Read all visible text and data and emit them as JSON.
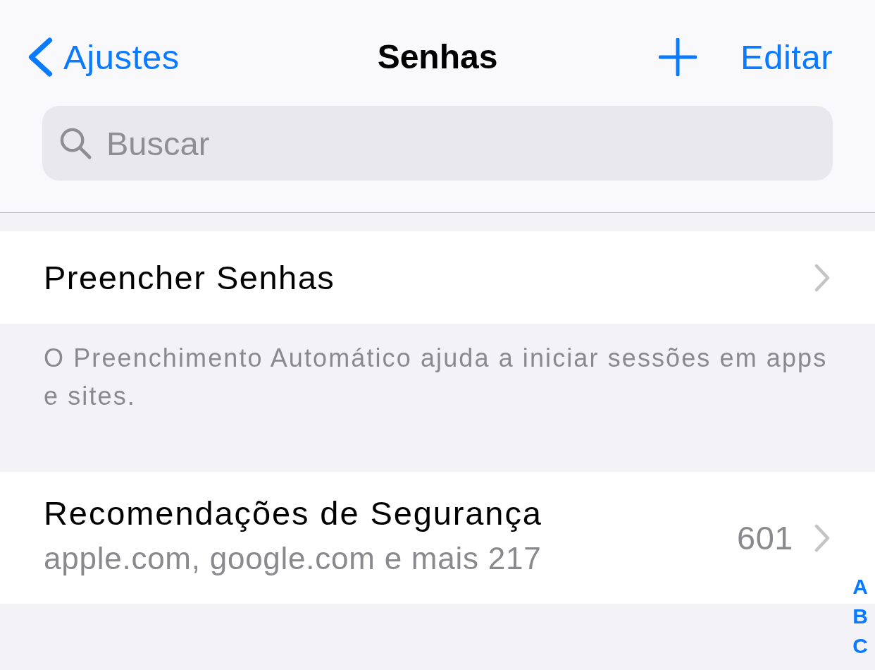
{
  "nav_bar": {
    "back_label": "Ajustes",
    "title": "Senhas",
    "edit_label": "Editar"
  },
  "search": {
    "placeholder": "Buscar"
  },
  "sections": [
    {
      "rows": [
        {
          "title": "Preencher Senhas"
        }
      ],
      "footer": "O Preenchimento Automático ajuda a iniciar sessões em apps e sites."
    },
    {
      "rows": [
        {
          "title": "Recomendações de Segurança",
          "subtitle": "apple.com, google.com e mais 217",
          "value": "601"
        }
      ]
    }
  ],
  "index_letters": [
    "A",
    "B",
    "C"
  ]
}
